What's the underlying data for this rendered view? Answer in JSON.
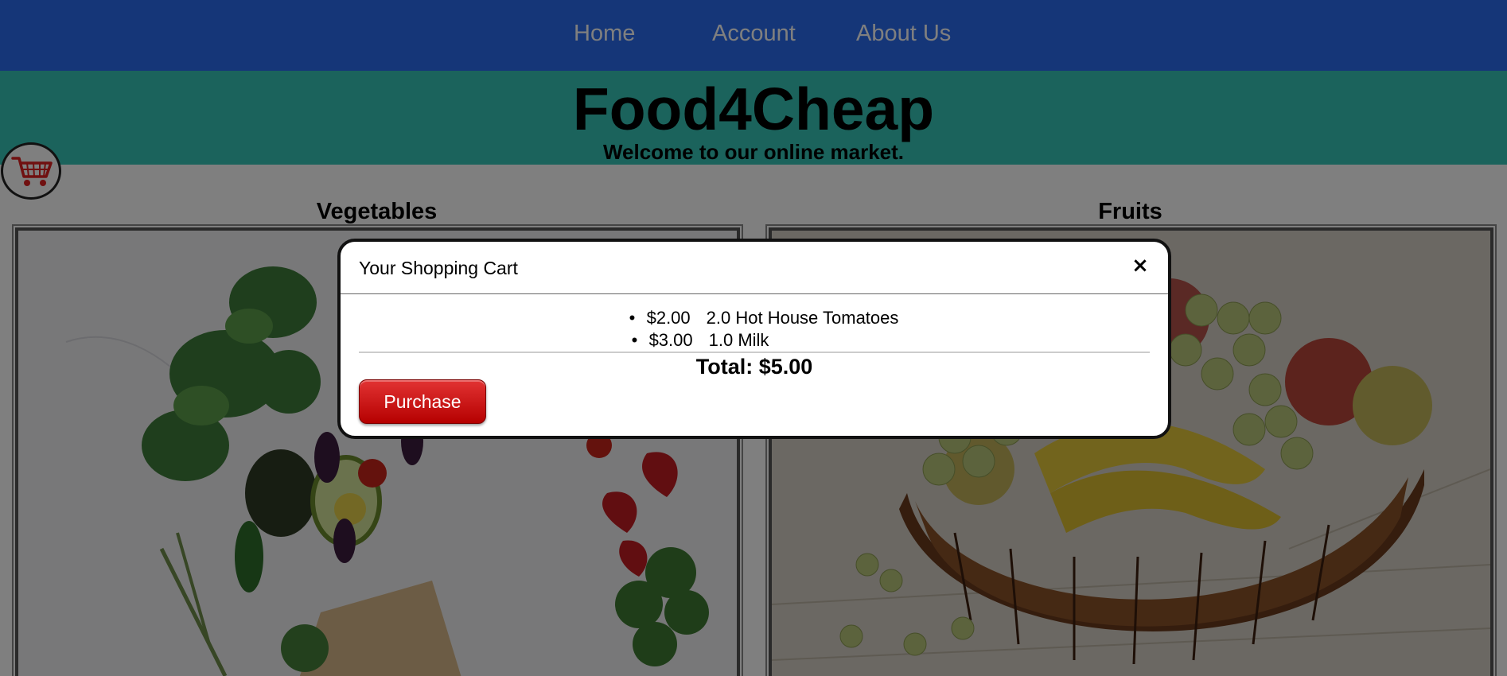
{
  "nav": {
    "home": "Home",
    "account": "Account",
    "about": "About Us"
  },
  "header": {
    "title": "Food4Cheap",
    "subtitle": "Welcome to our online market."
  },
  "categories": [
    {
      "label": "Vegetables"
    },
    {
      "label": "Fruits"
    }
  ],
  "cart_button": {
    "icon": "shopping-cart-icon"
  },
  "cart_modal": {
    "title": "Your Shopping Cart",
    "close_glyph": "×",
    "items": [
      {
        "price": "$2.00",
        "description": "2.0 Hot House Tomatoes"
      },
      {
        "price": "$3.00",
        "description": "1.0 Milk"
      }
    ],
    "total": "Total: $5.00",
    "purchase_label": "Purchase"
  },
  "colors": {
    "nav_bg": "#2a6cf0",
    "header_bg": "#36c7b8",
    "purchase_button": "#d10f0f"
  }
}
